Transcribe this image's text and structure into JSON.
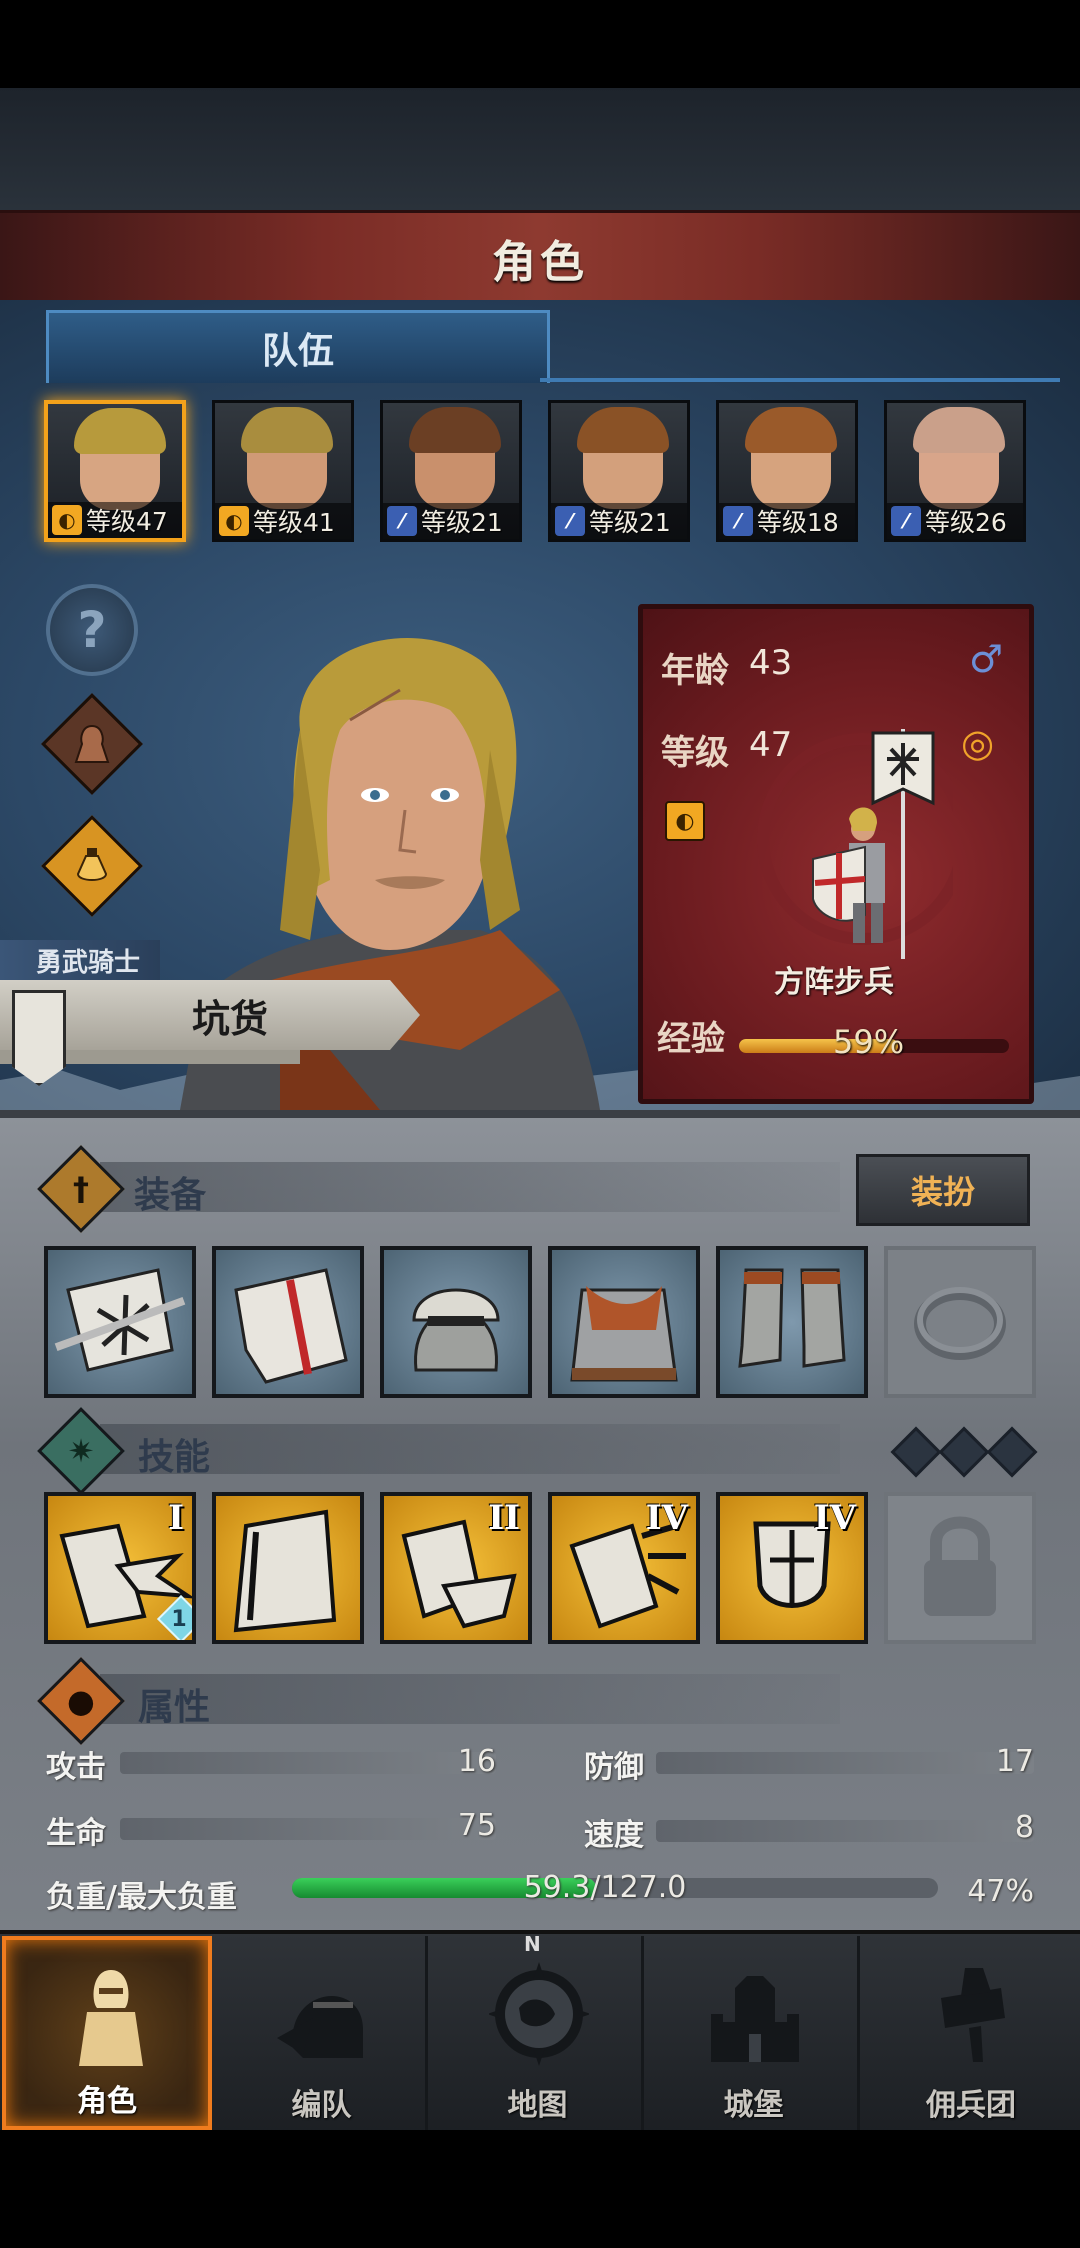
{
  "screen": {
    "title": "角色"
  },
  "team": {
    "tab_label": "队伍",
    "members": [
      {
        "level_text": "等级47",
        "class_icon": "shield-icon",
        "selected": true
      },
      {
        "level_text": "等级41",
        "class_icon": "shield-icon",
        "selected": false
      },
      {
        "level_text": "等级21",
        "class_icon": "sword-icon",
        "selected": false
      },
      {
        "level_text": "等级21",
        "class_icon": "sword-icon",
        "selected": false
      },
      {
        "level_text": "等级18",
        "class_icon": "sword-icon",
        "selected": false
      },
      {
        "level_text": "等级26",
        "class_icon": "sword-icon",
        "selected": false
      }
    ]
  },
  "side_buttons": {
    "help_glyph": "?"
  },
  "hero": {
    "class_label": "勇武骑士",
    "name": "坑货",
    "age_label": "年龄",
    "age": "43",
    "level_label": "等级",
    "level": "47",
    "unit_type": "方阵步兵",
    "xp_label": "经验",
    "xp_percent": "59%",
    "xp_fraction": 0.59
  },
  "equipment": {
    "title": "装备",
    "dress_button": "装扮",
    "slots": [
      "banner-icon",
      "shield-icon",
      "helmet-icon",
      "armor-icon",
      "boots-icon",
      "ring-icon"
    ]
  },
  "skills": {
    "title": "技能",
    "slots": [
      {
        "rank": "I",
        "badge": "1"
      },
      {
        "rank": "",
        "badge": ""
      },
      {
        "rank": "II",
        "badge": ""
      },
      {
        "rank": "IV",
        "badge": ""
      },
      {
        "rank": "IV",
        "badge": ""
      }
    ]
  },
  "attributes": {
    "title": "属性",
    "attack_label": "攻击",
    "attack": "16",
    "defense_label": "防御",
    "defense": "17",
    "hp_label": "生命",
    "hp": "75",
    "speed_label": "速度",
    "speed": "8",
    "load_label": "负重/最大负重",
    "load_value": "59.3/127.0",
    "load_percent": "47%",
    "load_fraction": 0.47
  },
  "nav": {
    "items": [
      {
        "label": "角色",
        "active": true
      },
      {
        "label": "编队",
        "active": false
      },
      {
        "label": "地图",
        "active": false
      },
      {
        "label": "城堡",
        "active": false
      },
      {
        "label": "佣兵团",
        "active": false
      }
    ],
    "compass_mark": "N"
  },
  "colors": {
    "accent": "#f3a21b",
    "panel_red": "#8f2b2e",
    "xp_fill": "#e9a830",
    "load_fill": "#2cb04a"
  }
}
